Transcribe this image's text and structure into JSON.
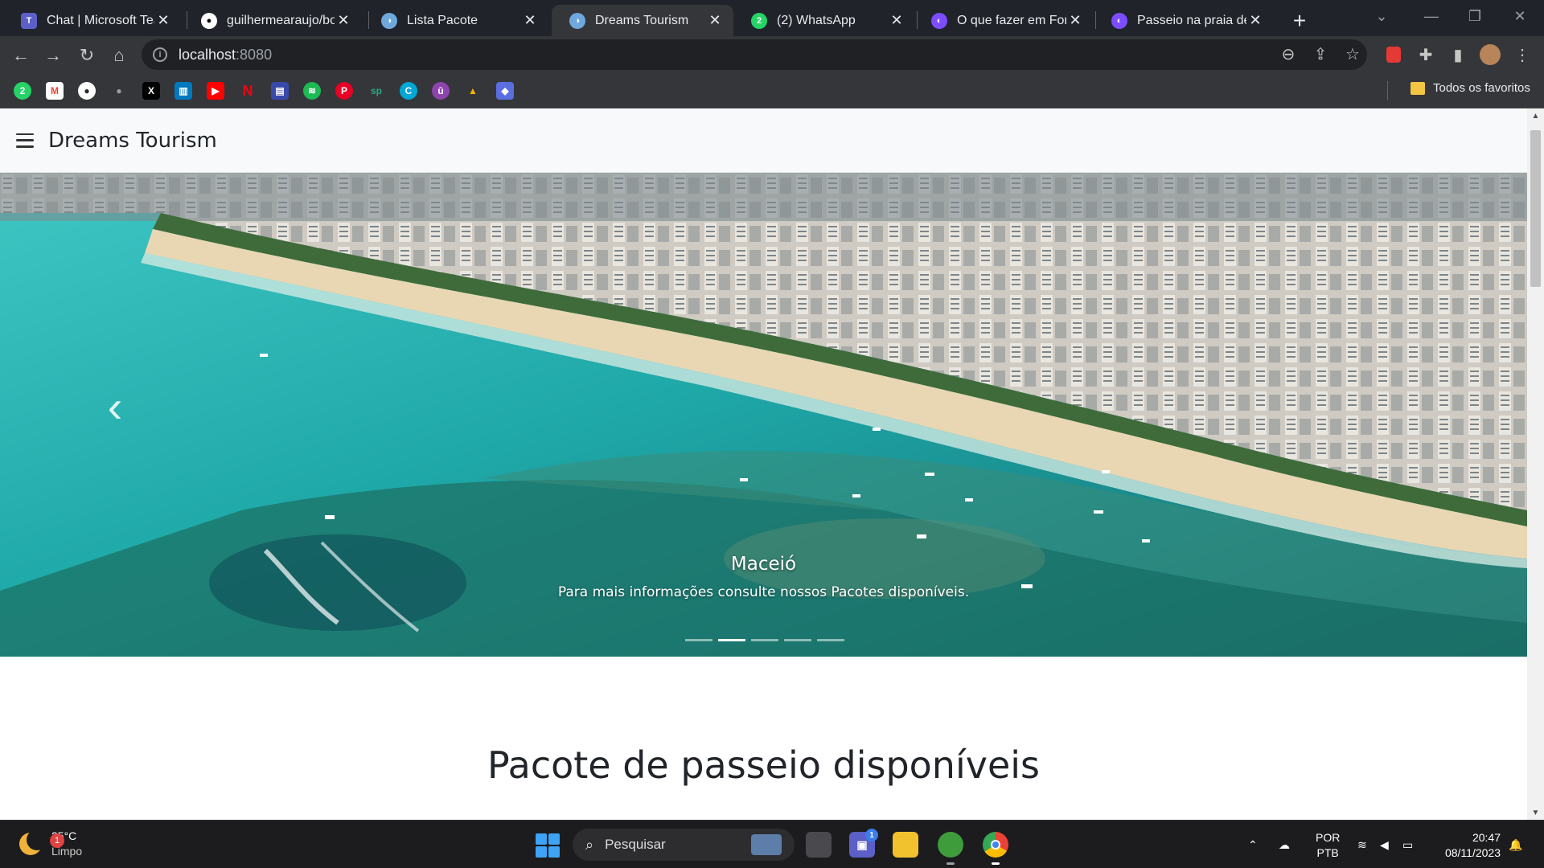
{
  "browser": {
    "tabs": [
      {
        "title": "Chat | Microsoft Teams",
        "icon": "teams-icon",
        "color": "#5b5fc7",
        "glyph": "T",
        "active": false
      },
      {
        "title": "guilhermearaujo/bol",
        "icon": "github-icon",
        "color": "#ffffff",
        "glyph": "",
        "active": false
      },
      {
        "title": "Lista Pacote",
        "icon": "vue-tab-icon",
        "color": "#6fa8dc",
        "glyph": "",
        "active": false
      },
      {
        "title": "Dreams Tourism",
        "icon": "vue-tab-icon",
        "color": "#6fa8dc",
        "glyph": "",
        "active": true
      },
      {
        "title": "(2) WhatsApp",
        "icon": "whatsapp-icon",
        "color": "#25d366",
        "glyph": "2",
        "active": false
      },
      {
        "title": "O que fazer em Forta",
        "icon": "site-icon",
        "color": "#7c4dff",
        "glyph": "",
        "active": false
      },
      {
        "title": "Passeio na praia de J",
        "icon": "site-icon",
        "color": "#7c4dff",
        "glyph": "",
        "active": false
      }
    ],
    "new_tab": "+",
    "url_host": "localhost",
    "url_port": ":8080",
    "bookmarks_folder": "Todos os favoritos",
    "bookmark_icons": [
      {
        "name": "whatsapp-bookmark-icon",
        "color": "#25d366",
        "glyph": "2"
      },
      {
        "name": "gmail-bookmark-icon",
        "color": "#ea4335",
        "glyph": "M"
      },
      {
        "name": "github-bookmark-icon",
        "color": "#24292e",
        "glyph": "◯"
      },
      {
        "name": "apple-bookmark-icon",
        "color": "#5f6368",
        "glyph": ""
      },
      {
        "name": "x-bookmark-icon",
        "color": "#000000",
        "glyph": "X"
      },
      {
        "name": "trello-bookmark-icon",
        "color": "#0079bf",
        "glyph": "▥"
      },
      {
        "name": "youtube-bookmark-icon",
        "color": "#ff0000",
        "glyph": "▶"
      },
      {
        "name": "netflix-bookmark-icon",
        "color": "#35363a",
        "glyph": "N"
      },
      {
        "name": "app-bookmark-icon",
        "color": "#3949ab",
        "glyph": "▤"
      },
      {
        "name": "spotify-bookmark-icon",
        "color": "#1db954",
        "glyph": "≋"
      },
      {
        "name": "pinterest-bookmark-icon",
        "color": "#e60023",
        "glyph": "P"
      },
      {
        "name": "sp-bookmark-icon",
        "color": "#2e7d6b",
        "glyph": "sp"
      },
      {
        "name": "canva-bookmark-icon",
        "color": "#00c4cc",
        "glyph": "C"
      },
      {
        "name": "u-bookmark-icon",
        "color": "#8e44ad",
        "glyph": "ū"
      },
      {
        "name": "drive-bookmark-icon",
        "color": "#f4b400",
        "glyph": "▲"
      },
      {
        "name": "copilot-bookmark-icon",
        "color": "#5b6ee1",
        "glyph": "◆"
      }
    ]
  },
  "page": {
    "brand": "Dreams Tourism",
    "carousel": {
      "caption_title": "Maceió",
      "caption_text": "Para mais informações consulte nossos Pacotes disponíveis.",
      "slide_count": 5,
      "active_slide": 2
    },
    "section_title": "Pacote de passeio disponíveis"
  },
  "taskbar": {
    "weather_temp": "25°C",
    "weather_desc": "Limpo",
    "weather_badge": "1",
    "search_placeholder": "Pesquisar",
    "lang_1": "POR",
    "lang_2": "PTB",
    "time": "20:47",
    "date": "08/11/2023",
    "teams_badge": "1"
  },
  "colors": {
    "accent": "#35363a",
    "page_bg": "#ffffff",
    "navbar_bg": "#f8f9fa"
  }
}
